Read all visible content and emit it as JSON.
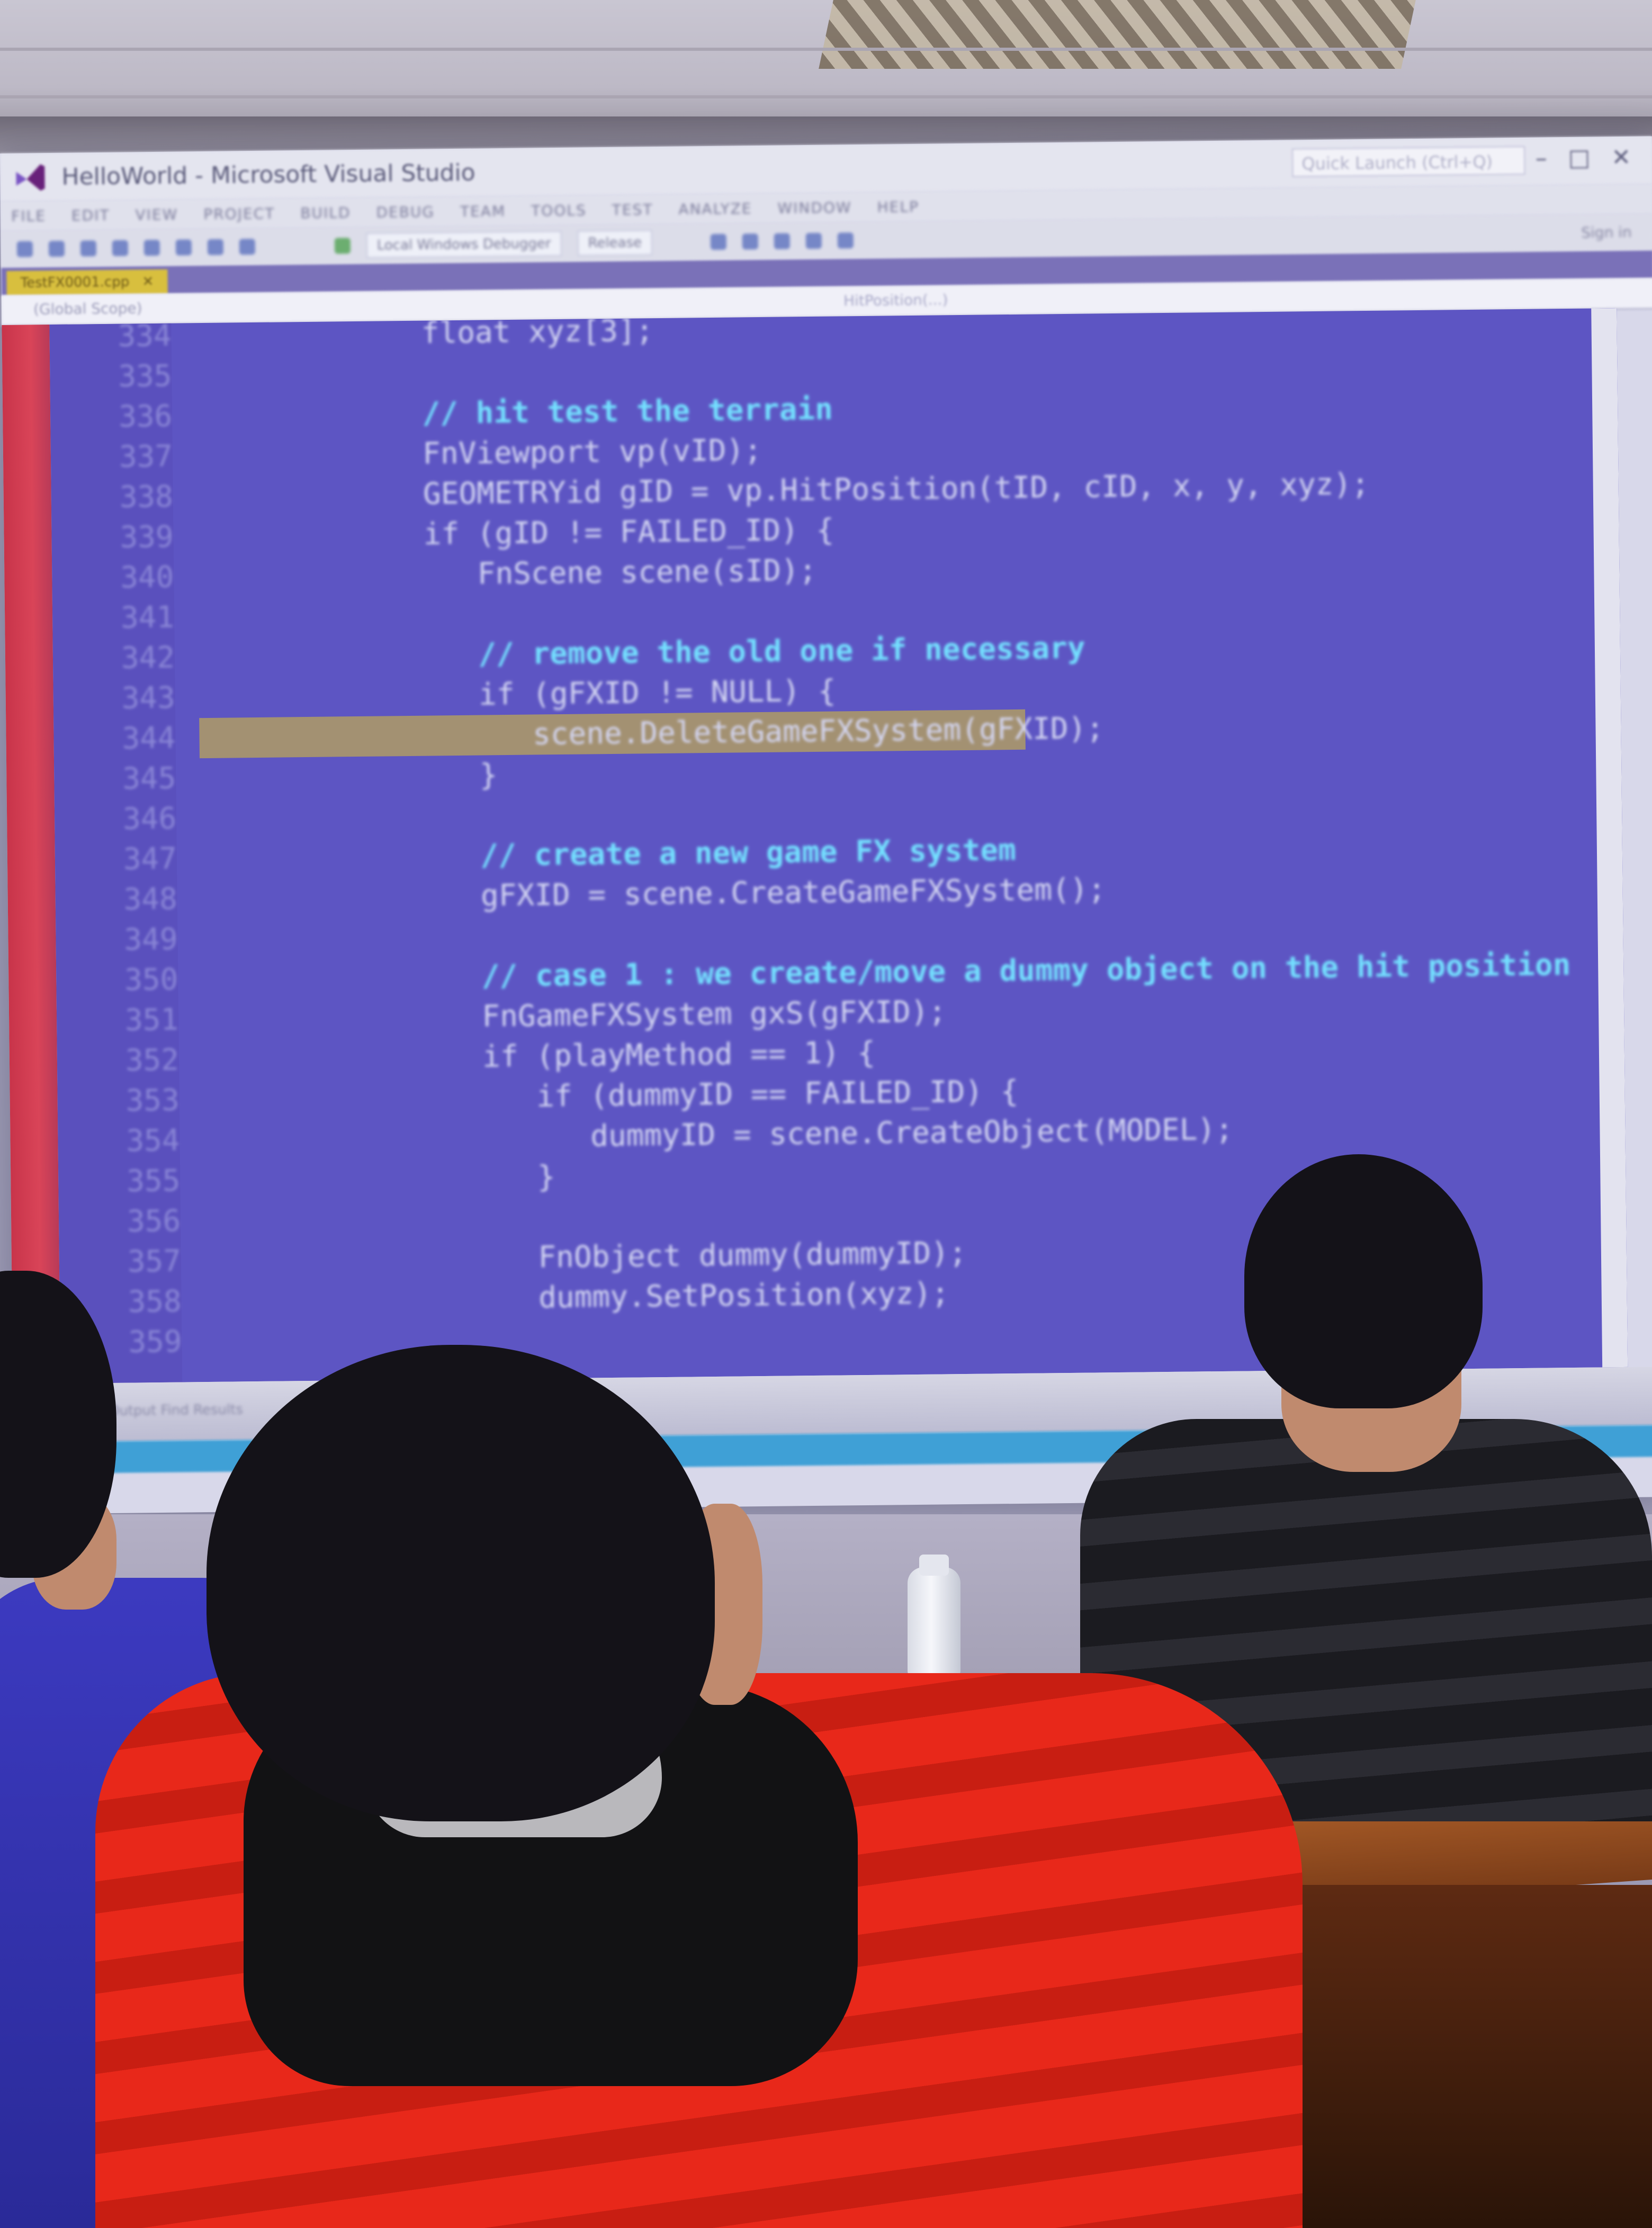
{
  "window": {
    "title": "HelloWorld - Microsoft Visual Studio",
    "quick_launch_placeholder": "Quick Launch (Ctrl+Q)",
    "sign_in": "Sign in"
  },
  "menu": [
    "FILE",
    "EDIT",
    "VIEW",
    "PROJECT",
    "BUILD",
    "DEBUG",
    "TEAM",
    "TOOLS",
    "TEST",
    "ANALYZE",
    "WINDOW",
    "HELP"
  ],
  "toolbar": {
    "debugger": "Local Windows Debugger",
    "config": "Release"
  },
  "tab": {
    "label": "TestFX0001.cpp"
  },
  "navbar": {
    "scope": "(Global Scope)",
    "member": "HitPosition(...)"
  },
  "code_lines": [
    {
      "num": "334",
      "text": "      float xyz[3];",
      "kind": "code"
    },
    {
      "num": "335",
      "text": "",
      "kind": "code"
    },
    {
      "num": "336",
      "text": "      // hit test the terrain",
      "kind": "comment"
    },
    {
      "num": "337",
      "text": "      FnViewport vp(vID);",
      "kind": "code"
    },
    {
      "num": "338",
      "text": "      GEOMETRYid gID = vp.HitPosition(tID, cID, x, y, xyz);",
      "kind": "code"
    },
    {
      "num": "339",
      "text": "      if (gID != FAILED_ID) {",
      "kind": "code"
    },
    {
      "num": "340",
      "text": "         FnScene scene(sID);",
      "kind": "code"
    },
    {
      "num": "341",
      "text": "",
      "kind": "code"
    },
    {
      "num": "342",
      "text": "         // remove the old one if necessary",
      "kind": "comment"
    },
    {
      "num": "343",
      "text": "         if (gFXID != NULL) {",
      "kind": "code"
    },
    {
      "num": "344",
      "text": "            scene.DeleteGameFXSystem(gFXID);",
      "kind": "code"
    },
    {
      "num": "345",
      "text": "         }",
      "kind": "code"
    },
    {
      "num": "346",
      "text": "",
      "kind": "code"
    },
    {
      "num": "347",
      "text": "         // create a new game FX system",
      "kind": "comment"
    },
    {
      "num": "348",
      "text": "         gFXID = scene.CreateGameFXSystem();",
      "kind": "code"
    },
    {
      "num": "349",
      "text": "",
      "kind": "code"
    },
    {
      "num": "350",
      "text": "         // case 1 : we create/move a dummy object on the hit position",
      "kind": "comment"
    },
    {
      "num": "351",
      "text": "         FnGameFXSystem gxS(gFXID);",
      "kind": "code"
    },
    {
      "num": "352",
      "text": "         if (playMethod == 1) {",
      "kind": "code"
    },
    {
      "num": "353",
      "text": "            if (dummyID == FAILED_ID) {",
      "kind": "code"
    },
    {
      "num": "354",
      "text": "               dummyID = scene.CreateObject(MODEL);",
      "kind": "code"
    },
    {
      "num": "355",
      "text": "            }",
      "kind": "code"
    },
    {
      "num": "356",
      "text": "",
      "kind": "code"
    },
    {
      "num": "357",
      "text": "            FnObject dummy(dummyID);",
      "kind": "code"
    },
    {
      "num": "358",
      "text": "            dummy.SetPosition(xyz);",
      "kind": "code"
    },
    {
      "num": "359",
      "text": "",
      "kind": "code"
    }
  ],
  "highlighted_line": "344",
  "status": {
    "output_tab": "Output  Find Results"
  },
  "colors": {
    "editor_bg": "#5d55c3",
    "comment": "#74e0ff",
    "code": "#d4d6f2",
    "highlight": "#a39172",
    "breakpoint_margin": "#c8344a",
    "tab_accent": "#d8bf3e"
  }
}
